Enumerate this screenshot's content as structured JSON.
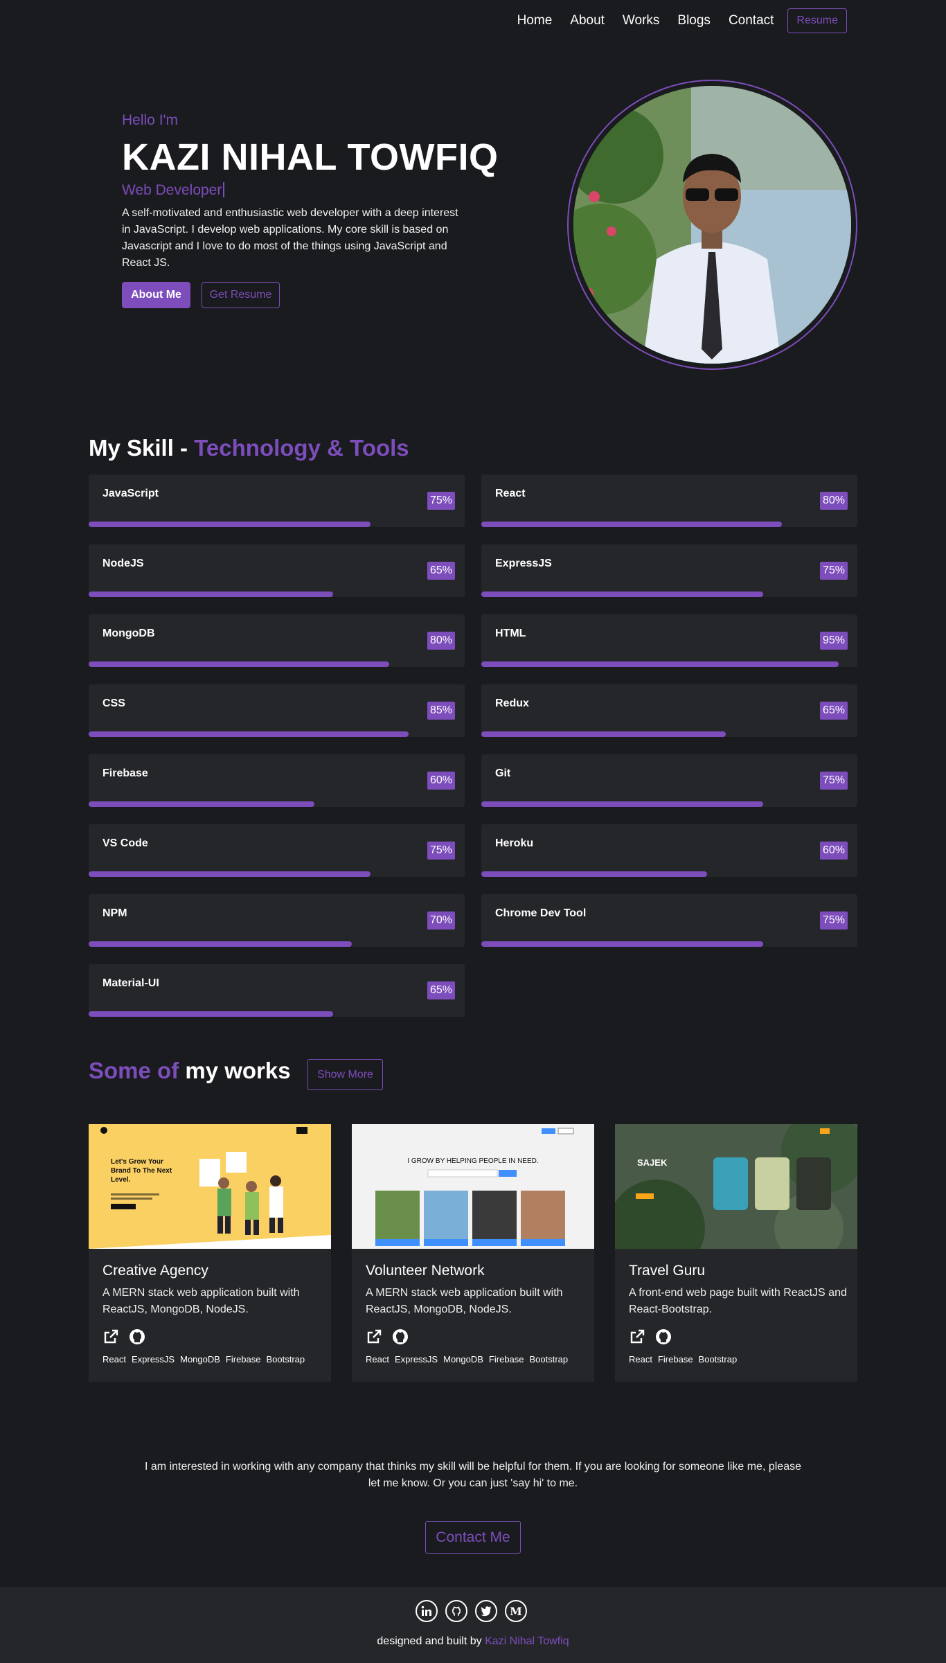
{
  "nav": {
    "items": [
      "Home",
      "About",
      "Works",
      "Blogs",
      "Contact"
    ],
    "resume_label": "Resume"
  },
  "hero": {
    "greeting": "Hello I'm",
    "name": "KAZI NIHAL TOWFIQ",
    "role": "Web Developer",
    "description": "A self-motivated and enthusiastic web developer with a deep interest in JavaScript. I develop web applications. My core skill is based on Javascript and I love to do most of the things using JavaScript and React JS.",
    "about_button": "About Me",
    "resume_button": "Get Resume"
  },
  "skills": {
    "title_main": "My Skill - ",
    "title_accent": "Technology & Tools",
    "items": [
      {
        "name": "JavaScript",
        "percent": "75%",
        "value": 75
      },
      {
        "name": "React",
        "percent": "80%",
        "value": 80
      },
      {
        "name": "NodeJS",
        "percent": "65%",
        "value": 65
      },
      {
        "name": "ExpressJS",
        "percent": "75%",
        "value": 75
      },
      {
        "name": "MongoDB",
        "percent": "80%",
        "value": 80
      },
      {
        "name": "HTML",
        "percent": "95%",
        "value": 95
      },
      {
        "name": "CSS",
        "percent": "85%",
        "value": 85
      },
      {
        "name": "Redux",
        "percent": "65%",
        "value": 65
      },
      {
        "name": "Firebase",
        "percent": "60%",
        "value": 60
      },
      {
        "name": "Git",
        "percent": "75%",
        "value": 75
      },
      {
        "name": "VS Code",
        "percent": "75%",
        "value": 75
      },
      {
        "name": "Heroku",
        "percent": "60%",
        "value": 60
      },
      {
        "name": "NPM",
        "percent": "70%",
        "value": 70
      },
      {
        "name": "Chrome Dev Tool",
        "percent": "75%",
        "value": 75
      },
      {
        "name": "Material-UI",
        "percent": "65%",
        "value": 65
      }
    ]
  },
  "works": {
    "title_accent": "Some of",
    "title_main": " my works",
    "show_more": "Show More",
    "projects": [
      {
        "title": "Creative Agency",
        "description": "A MERN stack web application built with ReactJS, MongoDB, NodeJS.",
        "tags": [
          "React",
          "ExpressJS",
          "MongoDB",
          "Firebase",
          "Bootstrap"
        ],
        "thumb_headline": "Let's Grow Your Brand To The Next Level."
      },
      {
        "title": "Volunteer Network",
        "description": "A MERN stack web application built with ReactJS, MongoDB, NodeJS.",
        "tags": [
          "React",
          "ExpressJS",
          "MongoDB",
          "Firebase",
          "Bootstrap"
        ],
        "thumb_headline": "I GROW BY HELPING PEOPLE IN NEED."
      },
      {
        "title": "Travel Guru",
        "description": "A front-end web page built with ReactJS and React-Bootstrap.",
        "tags": [
          "React",
          "Firebase",
          "Bootstrap"
        ],
        "thumb_headline": "SAJEK"
      }
    ]
  },
  "contact": {
    "text": "I am interested in working with any company that thinks my skill will be helpful for them. If you are looking for someone like me, please let me know. Or you can just 'say hi' to me.",
    "button": "Contact Me"
  },
  "footer": {
    "prefix": "designed and built by ",
    "author": "Kazi Nihal Towfiq"
  },
  "colors": {
    "accent": "#7c4dbb",
    "background": "#1a1b1e",
    "card": "#25262a"
  }
}
